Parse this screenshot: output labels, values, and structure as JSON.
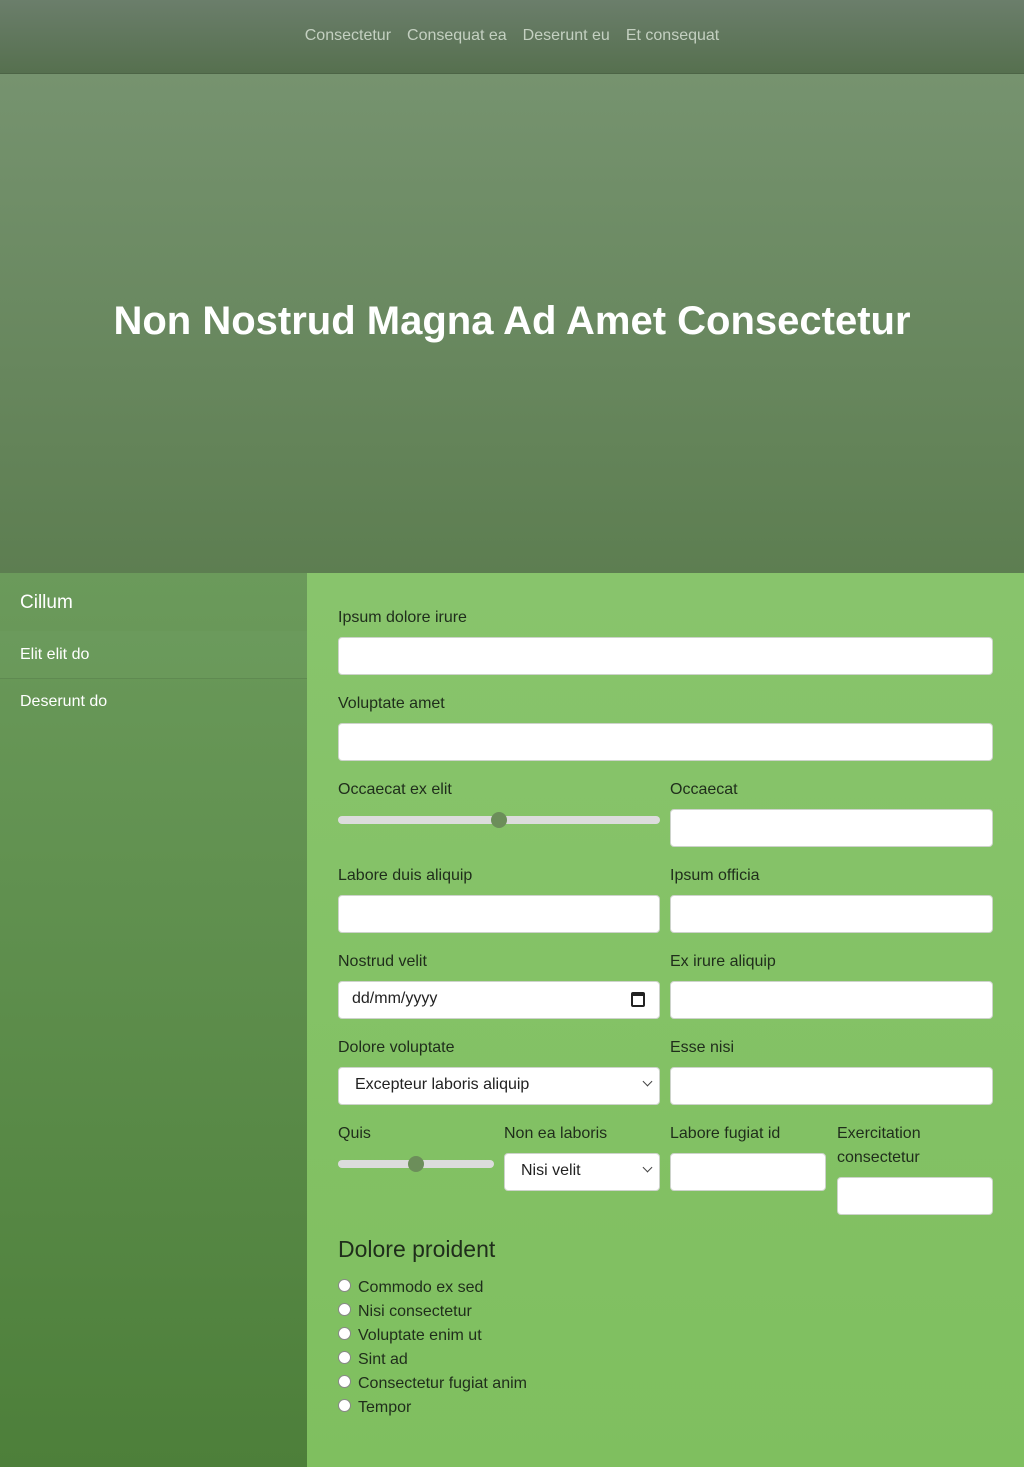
{
  "nav": {
    "items": [
      "Consectetur",
      "Consequat ea",
      "Deserunt eu",
      "Et consequat"
    ]
  },
  "hero": {
    "title": "Non Nostrud Magna Ad Amet Consectetur"
  },
  "sidebar": {
    "title": "Cillum",
    "items": [
      {
        "label": "Elit elit do"
      },
      {
        "label": "Deserunt do"
      }
    ]
  },
  "form": {
    "field1_label": "Ipsum dolore irure",
    "field2_label": "Voluptate amet",
    "range1_label": "Occaecat ex elit",
    "range1_value": 0.5,
    "field3_label": "Occaecat",
    "field4_label": "Labore duis aliquip",
    "field5_label": "Ipsum officia",
    "date_label": "Nostrud velit",
    "date_placeholder": "dd/mm/yyyy",
    "field6_label": "Ex irure aliquip",
    "select1_label": "Dolore voluptate",
    "select1_value": "Excepteur laboris aliquip",
    "field7_label": "Esse nisi",
    "range2_label": "Quis",
    "range2_value": 0.5,
    "select2_label": "Non ea laboris",
    "select2_value": "Nisi velit",
    "field8_label": "Labore fugiat id",
    "field9_label_line1": "Exercitation",
    "field9_label_line2": "consectetur",
    "radio_legend": "Dolore proident",
    "radio_options": [
      "Commodo ex sed",
      "Nisi consectetur",
      "Voluptate enim ut",
      "Sint ad",
      "Consectetur fugiat anim",
      "Tempor"
    ]
  },
  "colors": {
    "nav_bg": "#5f7759",
    "hero_bg": "#6b8a62",
    "sidebar_bg": "#5d8a4a",
    "main_bg": "#84c267",
    "slider_thumb": "#6c8e5a"
  }
}
